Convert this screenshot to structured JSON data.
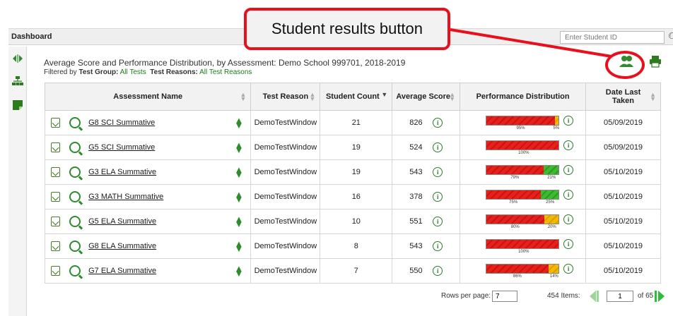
{
  "dashboard": {
    "title": "Dashboard",
    "search_placeholder": "Enter Student ID"
  },
  "header": {
    "title": "Average Score and Performance Distribution, by Assessment: Demo School 999701, 2018-2019",
    "filter_prefix": "Filtered by ",
    "test_group_label": "Test Group:",
    "test_group_value": "All Tests",
    "test_reasons_label": "Test Reasons:",
    "test_reasons_value": "All Test Reasons"
  },
  "callout": {
    "text": "Student results button"
  },
  "columns": [
    "Assessment Name",
    "Test Reason",
    "Student Count",
    "Average Score",
    "Performance Distribution",
    "Date Last Taken"
  ],
  "rows": [
    {
      "name": "G8 SCI Summative",
      "reason": "DemoTestWindow",
      "count": "21",
      "score": "826",
      "date": "05/09/2019",
      "dist": [
        95,
        5,
        0
      ],
      "labels": [
        "95%",
        "5%"
      ]
    },
    {
      "name": "G5 SCI Summative",
      "reason": "DemoTestWindow",
      "count": "19",
      "score": "524",
      "date": "05/09/2019",
      "dist": [
        100,
        0,
        0
      ],
      "labels": [
        "100%"
      ]
    },
    {
      "name": "G3 ELA Summative",
      "reason": "DemoTestWindow",
      "count": "19",
      "score": "543",
      "date": "05/10/2019",
      "dist": [
        79,
        0,
        21
      ],
      "labels": [
        "79%",
        "21%"
      ]
    },
    {
      "name": "G3 MATH Summative",
      "reason": "DemoTestWindow",
      "count": "16",
      "score": "378",
      "date": "05/10/2019",
      "dist": [
        75,
        0,
        25
      ],
      "labels": [
        "75%",
        "25%"
      ]
    },
    {
      "name": "G5 ELA Summative",
      "reason": "DemoTestWindow",
      "count": "10",
      "score": "551",
      "date": "05/10/2019",
      "dist": [
        80,
        20,
        0
      ],
      "labels": [
        "80%",
        "20%"
      ]
    },
    {
      "name": "G8 ELA Summative",
      "reason": "DemoTestWindow",
      "count": "8",
      "score": "543",
      "date": "05/10/2019",
      "dist": [
        100,
        0,
        0
      ],
      "labels": [
        "100%"
      ]
    },
    {
      "name": "G7 ELA Summative",
      "reason": "DemoTestWindow",
      "count": "7",
      "score": "550",
      "date": "05/10/2019",
      "dist": [
        86,
        14,
        0
      ],
      "labels": [
        "86%",
        "14%"
      ]
    }
  ],
  "pager": {
    "rows_label": "Rows per page:",
    "rows_value": "7",
    "items": "454 Items:",
    "page_value": "1",
    "of_pages": "of 65"
  },
  "colors": {
    "accent_green": "#2e8b2e",
    "callout_red": "#e8101c",
    "bar_red": "#e8201c",
    "bar_yellow": "#f5b800",
    "bar_green": "#3dbb2e"
  },
  "icons": {
    "collapse": "collapse-arrows-icon",
    "org": "org-chart-icon",
    "note": "note-icon",
    "students": "student-results-icon",
    "print": "print-icon",
    "search": "search-icon"
  }
}
